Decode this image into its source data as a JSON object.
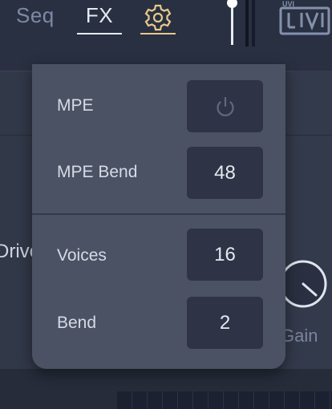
{
  "topbar": {
    "tabs": [
      {
        "label": "Seq"
      },
      {
        "label": "FX"
      }
    ],
    "logo": "UVI"
  },
  "background": {
    "drive_label": "Drive",
    "gain_label": "Gain"
  },
  "popup": {
    "rows": [
      {
        "label": "MPE",
        "value": "",
        "icon": "power-icon"
      },
      {
        "label": "MPE Bend",
        "value": "48"
      },
      {
        "label": "Voices",
        "value": "16"
      },
      {
        "label": "Bend",
        "value": "2"
      }
    ]
  },
  "colors": {
    "accent": "#e8c98b",
    "popup_bg": "#4a5263",
    "value_box_bg": "#2e3445"
  }
}
